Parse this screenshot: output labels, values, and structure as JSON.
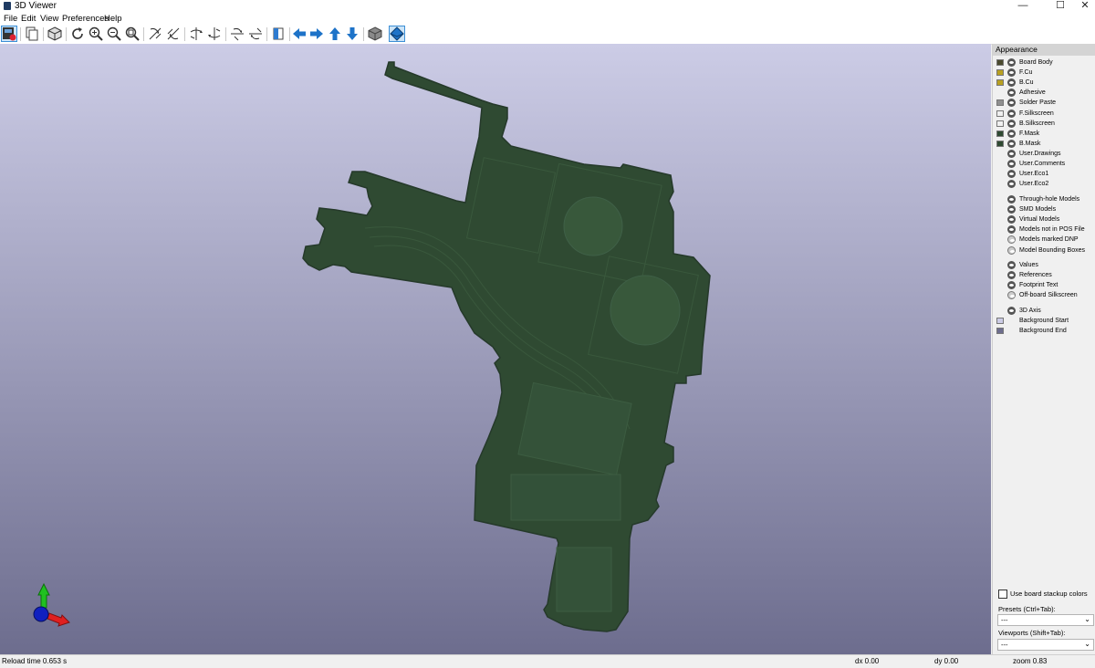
{
  "window": {
    "title": "3D Viewer",
    "minimize": "—",
    "maximize": "☐",
    "close": "✕"
  },
  "menu": [
    "File",
    "Edit",
    "View",
    "Preferences",
    "Help"
  ],
  "toolbar": {
    "icons": [
      "render-raytrace-icon",
      "copy-image-icon",
      "3d-box-icon",
      "reload-icon",
      "zoom-in-icon",
      "zoom-out-icon",
      "zoom-fit-icon",
      "rotate-x-cw-icon",
      "rotate-x-ccw-icon",
      "rotate-y-cw-icon",
      "rotate-y-ccw-icon",
      "rotate-z-cw-icon",
      "rotate-z-ccw-icon",
      "flip-board-icon",
      "pan-left-icon",
      "pan-right-icon",
      "pan-up-icon",
      "pan-down-icon",
      "ortho-icon",
      "toggle-view-icon"
    ]
  },
  "appearance": {
    "header": "Appearance",
    "layers": [
      {
        "label": "Board Body",
        "swatch": "#4a4a2e",
        "type": "eye"
      },
      {
        "label": "F.Cu",
        "swatch": "#b8a020",
        "type": "eye"
      },
      {
        "label": "B.Cu",
        "swatch": "#b8a020",
        "type": "eye"
      },
      {
        "label": "Adhesive",
        "swatch": "",
        "type": "eye"
      },
      {
        "label": "Solder Paste",
        "swatch": "#909090",
        "type": "eye"
      },
      {
        "label": "F.Silkscreen",
        "swatch": "#f0f0f0",
        "type": "eye"
      },
      {
        "label": "B.Silkscreen",
        "swatch": "#f0f0f0",
        "type": "eye"
      },
      {
        "label": "F.Mask",
        "swatch": "#2f4a32",
        "type": "eye"
      },
      {
        "label": "B.Mask",
        "swatch": "#2f4a32",
        "type": "eye"
      },
      {
        "label": "User.Drawings",
        "swatch": "",
        "type": "eye"
      },
      {
        "label": "User.Comments",
        "swatch": "",
        "type": "eye"
      },
      {
        "label": "User.Eco1",
        "swatch": "",
        "type": "eye"
      },
      {
        "label": "User.Eco2",
        "swatch": "",
        "type": "eye"
      }
    ],
    "models": [
      {
        "label": "Through-hole Models",
        "type": "eye"
      },
      {
        "label": "SMD Models",
        "type": "eye"
      },
      {
        "label": "Virtual Models",
        "type": "eye"
      },
      {
        "label": "Models not in POS File",
        "type": "eye"
      },
      {
        "label": "Models marked DNP",
        "type": "hidden"
      },
      {
        "label": "Model Bounding Boxes",
        "type": "hidden"
      }
    ],
    "text": [
      {
        "label": "Values",
        "type": "eye"
      },
      {
        "label": "References",
        "type": "eye"
      },
      {
        "label": "Footprint Text",
        "type": "eye"
      },
      {
        "label": "Off-board Silkscreen",
        "type": "hidden"
      }
    ],
    "misc": [
      {
        "label": "3D Axis",
        "swatch": "",
        "type": "eye"
      },
      {
        "label": "Background Start",
        "swatch": "#cccce6",
        "type": "none"
      },
      {
        "label": "Background End",
        "swatch": "#6d6d8e",
        "type": "none"
      }
    ],
    "stackup_label": "Use board stackup colors",
    "presets_label": "Presets (Ctrl+Tab):",
    "presets_value": "---",
    "viewports_label": "Viewports (Shift+Tab):",
    "viewports_value": "---"
  },
  "status": {
    "reload": "Reload time 0.653 s",
    "dx": "dx 0.00",
    "dy": "dy 0.00",
    "zoom": "zoom 0.83"
  },
  "colors": {
    "board": "#2f4a32",
    "board_edge": "#25392a",
    "bg_top": "#cccce6",
    "bg_bottom": "#6d6d8e"
  }
}
